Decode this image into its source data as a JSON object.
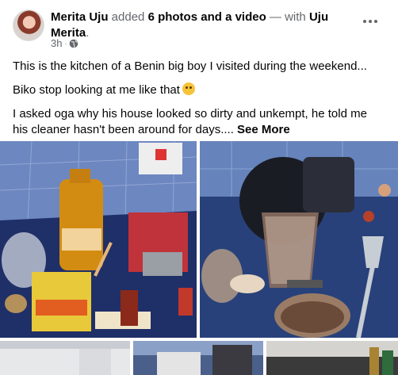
{
  "post": {
    "author": "Merita Uju",
    "action_added": " added ",
    "action_media": "6 photos and a video",
    "action_with": " — with ",
    "tagged": "Uju Merita",
    "period": ".",
    "time": "3h",
    "dot": "·",
    "privacy_icon": "globe-icon",
    "menu_icon": "more-options-icon"
  },
  "content": {
    "line1": "This is the kitchen of a Benin big boy I visited during the weekend...",
    "line2": "Biko stop looking at me like that",
    "line2_emoji": "flushed-face-emoji",
    "line3": "I asked oga why his house looked so dirty and  unkempt, he told me his cleaner hasn't been around for days.... ",
    "see_more": "See More"
  },
  "photos": [
    {
      "name": "photo-counter-groceries"
    },
    {
      "name": "photo-blender-kettle"
    },
    {
      "name": "photo-bottom-1"
    },
    {
      "name": "photo-bottom-2"
    },
    {
      "name": "photo-bottom-3"
    }
  ],
  "colors": {
    "link": "#050505",
    "secondary": "#65676b",
    "counter_blue": "#24336a",
    "tile_wall": "#5b7ab8"
  }
}
